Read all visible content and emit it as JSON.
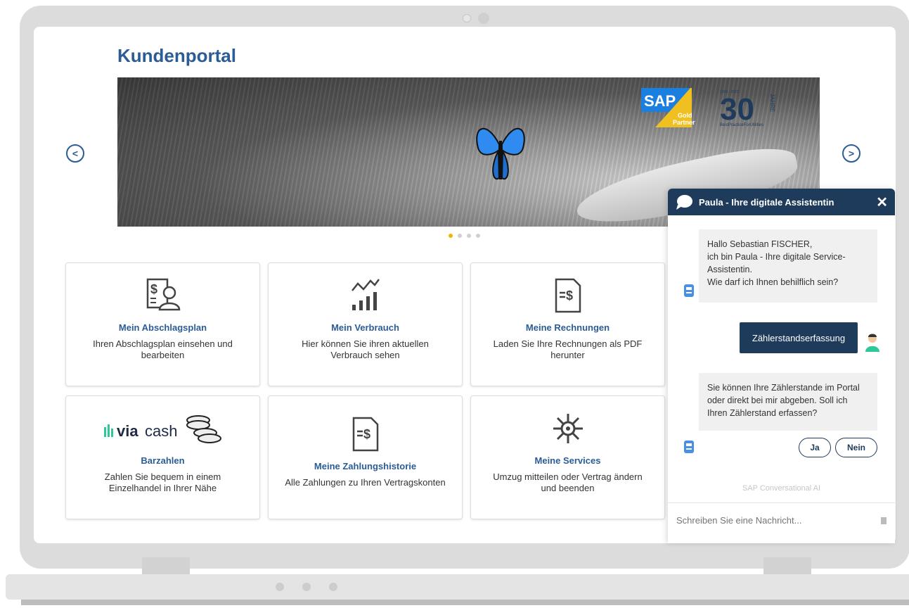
{
  "page": {
    "title": "Kundenportal"
  },
  "carousel": {
    "prev": "<",
    "next": ">",
    "slide_count": 4,
    "active_slide": 1
  },
  "branding": {
    "sap": "SAP",
    "gold": "Gold",
    "partner": "Partner",
    "years_range": "1993 - 2023",
    "thirty": "30",
    "jahre": "JAHRE",
    "tagline": "BestPracticeForUtilities"
  },
  "tiles": [
    {
      "title": "Mein Abschlagsplan",
      "desc": "Ihren Abschlagsplan einsehen und bearbeiten"
    },
    {
      "title": "Mein Verbrauch",
      "desc": "Hier können Sie ihren aktuellen Verbrauch sehen"
    },
    {
      "title": "Meine Rechnungen",
      "desc": "Laden Sie Ihre Rechnungen als PDF herunter"
    },
    {
      "title": "Barzahlen",
      "desc": "Zahlen Sie bequem in einem Einzelhandel in Ihrer Nähe",
      "logo_via": "via",
      "logo_cash": "cash"
    },
    {
      "title": "Meine Zahlungshistorie",
      "desc": "Alle Zahlungen zu Ihren Vertragskonten"
    },
    {
      "title": "Meine Services",
      "desc": "Umzug mitteilen oder Vertrag ändern und beenden"
    }
  ],
  "chat": {
    "title": "Paula - Ihre digitale Assistentin",
    "close": "✕",
    "msg1": "Hallo Sebastian FISCHER,\nich bin Paula - Ihre digitale Service-Assistentin.\nWie darf ich Ihnen behilflich sein?",
    "user_msg": "Zählerstandserfassung",
    "msg2": "Sie können Ihre Zählerstande im Portal oder direkt bei mir abgeben. Soll ich Ihren Zählerstand erfassen?",
    "reply_yes": "Ja",
    "reply_no": "Nein",
    "powered": "SAP Conversational AI",
    "input_placeholder": "Schreiben Sie eine Nachricht..."
  }
}
